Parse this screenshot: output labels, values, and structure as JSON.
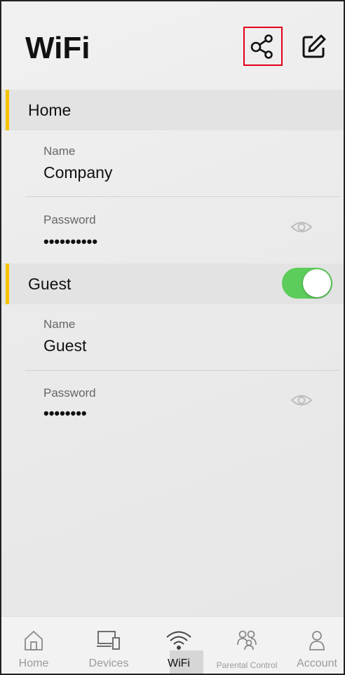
{
  "header": {
    "title": "WiFi"
  },
  "home_network": {
    "section_label": "Home",
    "name_label": "Name",
    "name_value": "Company",
    "password_label": "Password",
    "password_value": "••••••••••"
  },
  "guest_network": {
    "section_label": "Guest",
    "enabled": true,
    "name_label": "Name",
    "name_value": "Guest",
    "password_label": "Password",
    "password_value": "••••••••"
  },
  "bottom_nav": {
    "items": [
      {
        "label": "Home",
        "icon": "home-icon"
      },
      {
        "label": "Devices",
        "icon": "devices-icon"
      },
      {
        "label": "WiFi",
        "icon": "wifi-icon",
        "active": true
      },
      {
        "label": "Parental Control",
        "icon": "parental-control-icon"
      },
      {
        "label": "Account",
        "icon": "account-icon"
      }
    ]
  },
  "colors": {
    "accent_bar": "#f5c400",
    "toggle_on": "#5ccc5a",
    "highlight_border": "#e2001a"
  }
}
